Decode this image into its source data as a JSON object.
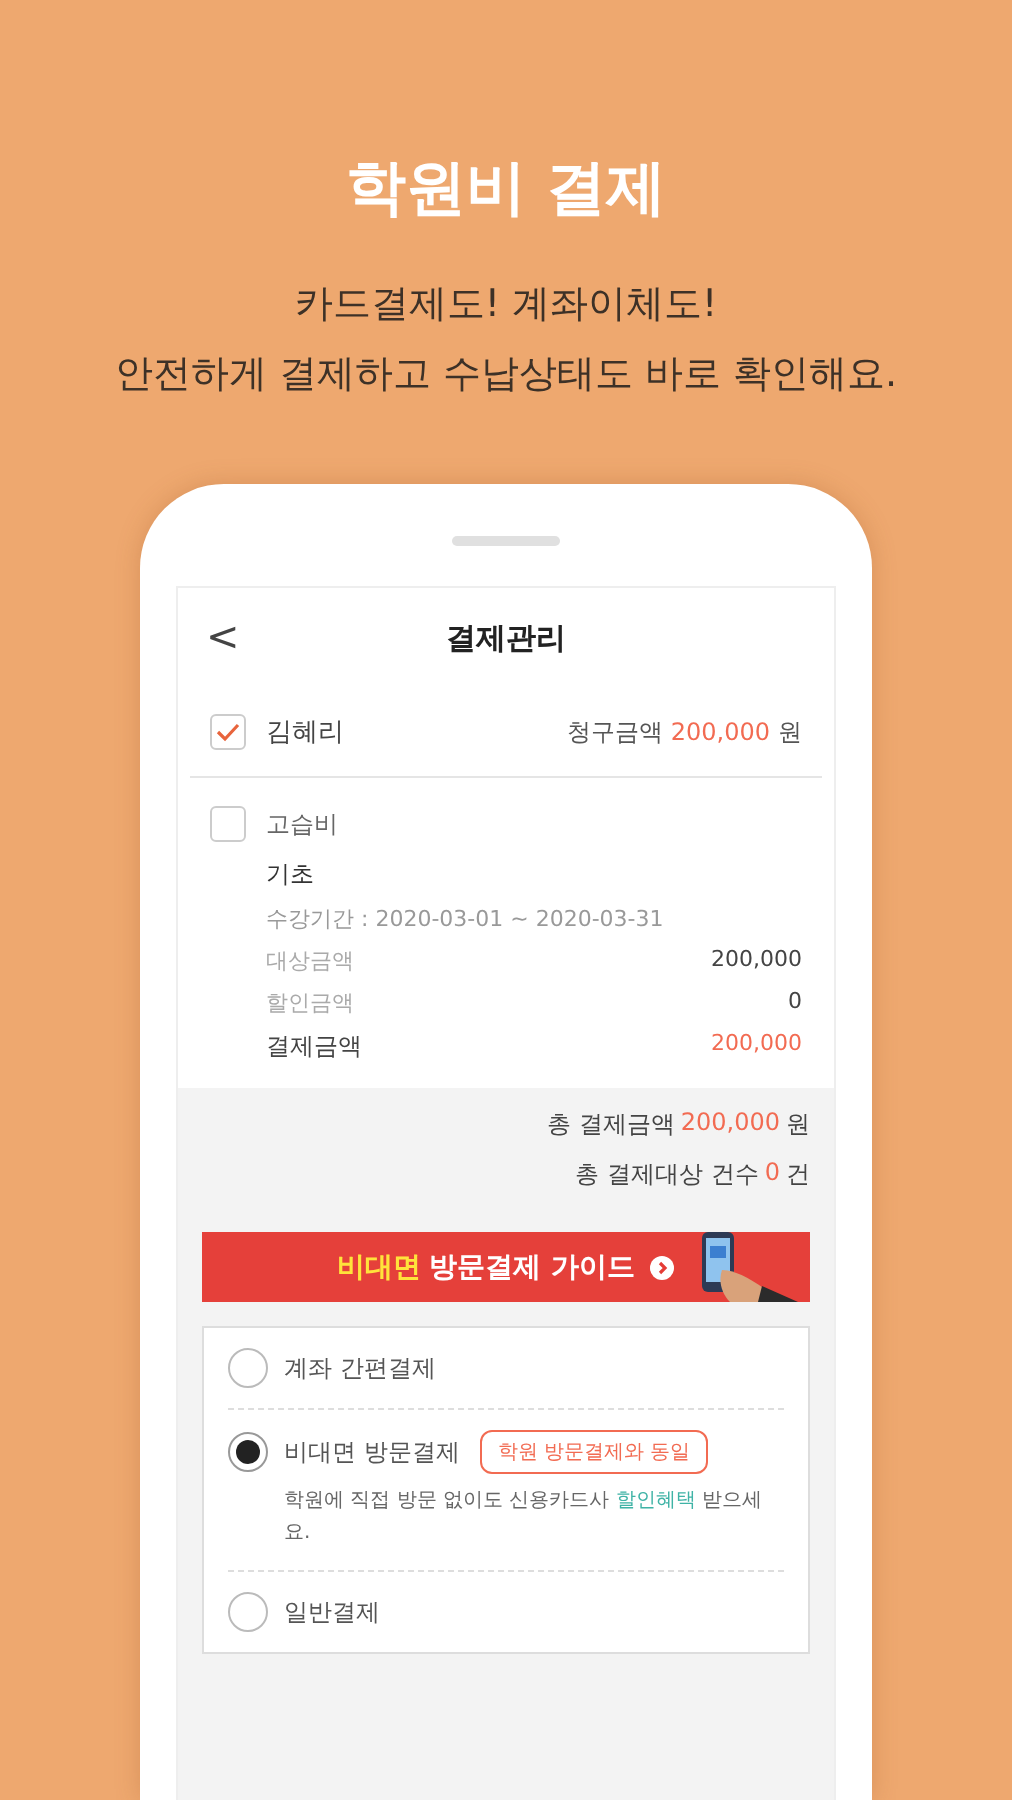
{
  "headline": {
    "title": "학원비 결제",
    "lines": [
      "카드결제도! 계좌이체도!",
      "안전하게 결제하고 수납상태도 바로 확인해요."
    ]
  },
  "screen": {
    "title": "결제관리",
    "back": "<",
    "student": {
      "name": "김혜리",
      "checked": true,
      "label": "청구금액",
      "amount": "200,000",
      "unit": "원"
    },
    "fee": {
      "name": "고습비",
      "checked": false,
      "course": "기초",
      "period": "수강기간 : 2020-03-01 ~ 2020-03-31",
      "rows": [
        {
          "label": "대상금액",
          "value": "200,000",
          "kind": "plain"
        },
        {
          "label": "할인금액",
          "value": "0",
          "kind": "plain"
        },
        {
          "label": "결제금액",
          "value": "200,000",
          "kind": "total"
        }
      ]
    },
    "totals": [
      {
        "label": "총 결제금액",
        "value": "200,000",
        "unit": "원"
      },
      {
        "label": "총 결제대상 건수",
        "value": "0",
        "unit": "건"
      }
    ],
    "banner": {
      "highlight": "비대면",
      "text": "방문결제 가이드"
    },
    "methods": [
      {
        "label": "계좌 간편결제",
        "selected": false
      },
      {
        "label": "비대면 방문결제",
        "selected": true,
        "tag": "학원 방문결제와 동일",
        "desc": [
          "학원에 직접 방문 없이도 신용카드사 ",
          "할인혜택",
          " 받으세요."
        ]
      },
      {
        "label": "일반결제",
        "selected": false
      }
    ]
  }
}
